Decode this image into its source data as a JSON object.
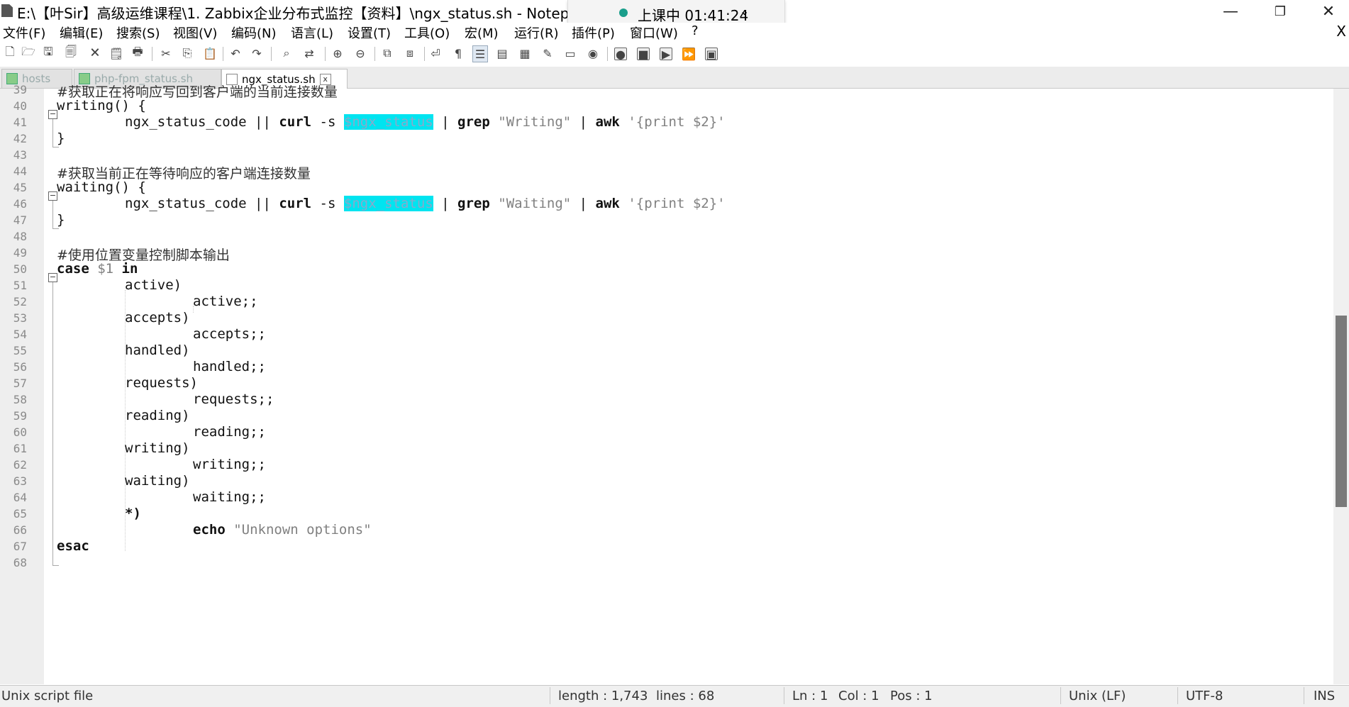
{
  "window": {
    "title": "E:\\【叶Sir】高级运维课程\\1. Zabbix企业分布式监控【资料】\\ngx_status.sh - Notepad++ [Adm",
    "min_icon": "—",
    "max_icon": "❐",
    "close_icon": "✕"
  },
  "overlay": {
    "text": "上课中 01:41:24",
    "chevron": "⌄"
  },
  "menu": {
    "items": [
      "文件(F)",
      "编辑(E)",
      "搜索(S)",
      "视图(V)",
      "编码(N)",
      "语言(L)",
      "设置(T)",
      "工具(O)",
      "宏(M)",
      "运行(R)",
      "插件(P)",
      "窗口(W)",
      "?"
    ],
    "close": "X"
  },
  "tabs": [
    {
      "label": "hosts",
      "active": false
    },
    {
      "label": "php-fpm_status.sh",
      "active": false
    },
    {
      "label": "ngx_status.sh",
      "active": true,
      "close": "x"
    }
  ],
  "editor": {
    "lines": [
      {
        "n": "39",
        "text": "#获取正在将响应写回到客户端的当前连接数量"
      },
      {
        "n": "40",
        "text": "writing() {"
      },
      {
        "n": "41",
        "a": "ngx_status_code || ",
        "b": "curl",
        "c": " -s ",
        "hl": "$ngx_status",
        "d": " | ",
        "e": "grep",
        "f": " ",
        "g": "\"Writing\"",
        "h": " | ",
        "i": "awk",
        "j": " ",
        "k": "'{print $2}'"
      },
      {
        "n": "42",
        "text": "}"
      },
      {
        "n": "43",
        "text": ""
      },
      {
        "n": "44",
        "text": "#获取当前正在等待响应的客户端连接数量"
      },
      {
        "n": "45",
        "text": "waiting() {"
      },
      {
        "n": "46",
        "a": "ngx_status_code || ",
        "b": "curl",
        "c": " -s ",
        "hl": "$ngx_status",
        "d": " | ",
        "e": "grep",
        "f": " ",
        "g": "\"Waiting\"",
        "h": " | ",
        "i": "awk",
        "j": " ",
        "k": "'{print $2}'"
      },
      {
        "n": "47",
        "text": "}"
      },
      {
        "n": "48",
        "text": ""
      },
      {
        "n": "49",
        "text": "#使用位置变量控制脚本输出"
      },
      {
        "n": "50",
        "kw": "case",
        "var": " $1 ",
        "kw2": "in"
      },
      {
        "n": "51",
        "text": "active)"
      },
      {
        "n": "52",
        "text": "active;;"
      },
      {
        "n": "53",
        "text": "accepts)"
      },
      {
        "n": "54",
        "text": "accepts;;"
      },
      {
        "n": "55",
        "text": "handled)"
      },
      {
        "n": "56",
        "text": "handled;;"
      },
      {
        "n": "57",
        "text": "requests)"
      },
      {
        "n": "58",
        "text": "requests;;"
      },
      {
        "n": "59",
        "text": "reading)"
      },
      {
        "n": "60",
        "text": "reading;;"
      },
      {
        "n": "61",
        "text": "writing)"
      },
      {
        "n": "62",
        "text": "writing;;"
      },
      {
        "n": "63",
        "text": "waiting)"
      },
      {
        "n": "64",
        "text": "waiting;;"
      },
      {
        "n": "65",
        "text": "*)"
      },
      {
        "n": "66",
        "kw": "echo",
        "str": " \"Unknown options\""
      },
      {
        "n": "67",
        "kw": "esac"
      },
      {
        "n": "68",
        "text": ""
      }
    ]
  },
  "status": {
    "filetype": "Unix script file",
    "length": "length : 1,743",
    "lines": "lines : 68",
    "ln": "Ln : 1",
    "col": "Col : 1",
    "pos": "Pos : 1",
    "eol": "Unix (LF)",
    "encoding": "UTF-8",
    "mode": "INS"
  }
}
